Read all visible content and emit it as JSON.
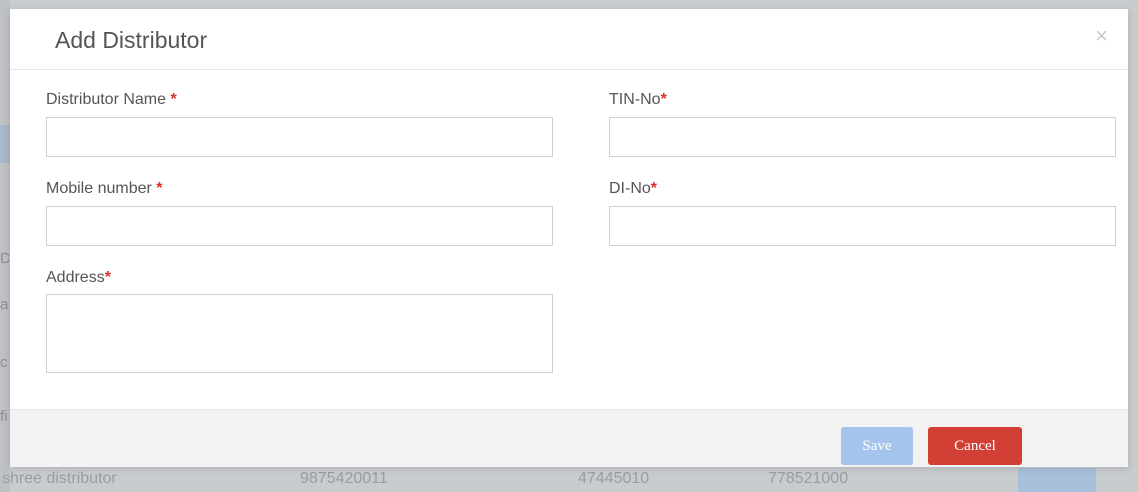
{
  "background": {
    "left_fragments": [
      "D",
      "a",
      "c",
      "fi"
    ],
    "row": [
      "shree distributor",
      "9875420011",
      "47445010",
      "778521000"
    ]
  },
  "modal": {
    "title": "Add Distributor",
    "close_glyph": "×",
    "required_marker": "*",
    "fields": {
      "distributor_name": {
        "label": "Distributor Name ",
        "value": ""
      },
      "tin_no": {
        "label": "TIN-No",
        "value": ""
      },
      "mobile_number": {
        "label": "Mobile number ",
        "value": ""
      },
      "dl_no": {
        "label": "DI-No",
        "value": ""
      },
      "address": {
        "label": "Address",
        "value": ""
      }
    },
    "footer": {
      "save_label": "Save",
      "cancel_label": "Cancel"
    }
  },
  "colors": {
    "required": "#d9312a",
    "save_button": "#a4c4ec",
    "cancel_button": "#d23f34",
    "footer_bg": "#f2f2f2"
  }
}
